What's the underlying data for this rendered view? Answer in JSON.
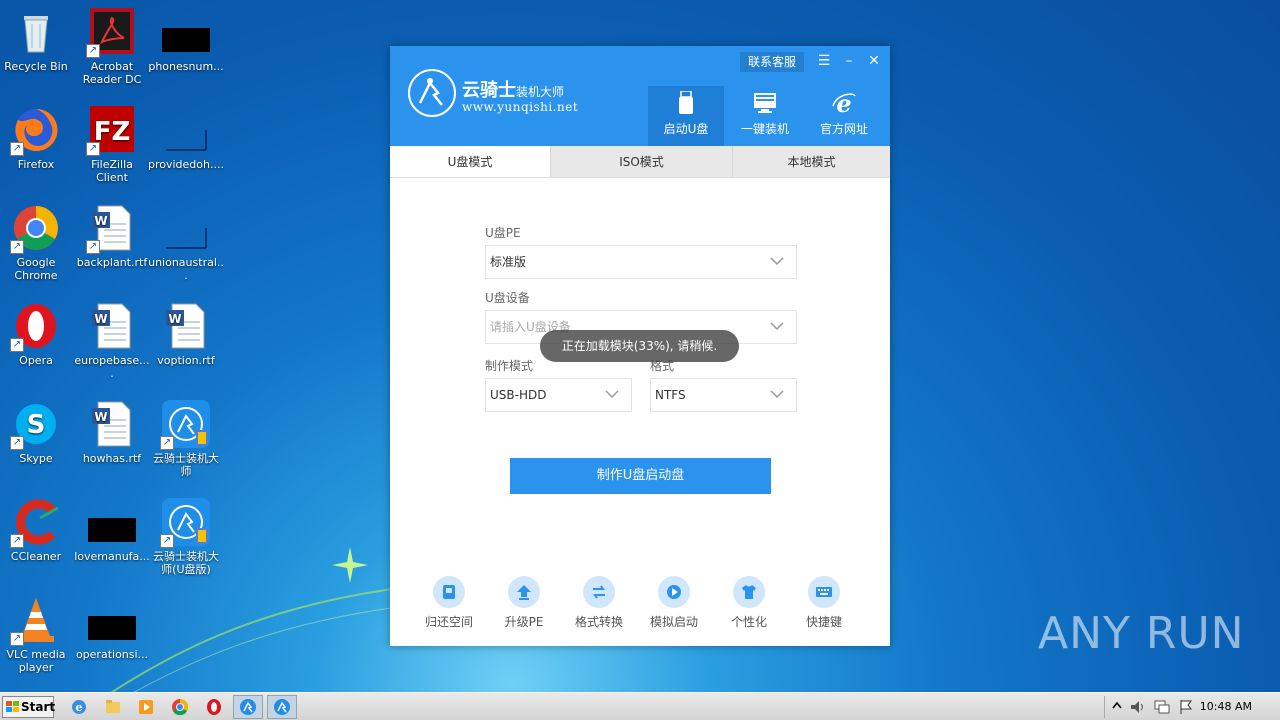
{
  "desktop": {
    "icons": [
      {
        "label": "Recycle Bin",
        "icon": "recycle-bin-icon"
      },
      {
        "label": "Acrobat Reader DC",
        "icon": "acrobat-icon"
      },
      {
        "label": "phonesnum...",
        "icon": "black-file-icon"
      },
      {
        "label": "Firefox",
        "icon": "firefox-icon"
      },
      {
        "label": "FileZilla Client",
        "icon": "filezilla-icon"
      },
      {
        "label": "providedoh....",
        "icon": "blank-file-icon"
      },
      {
        "label": "Google Chrome",
        "icon": "chrome-icon"
      },
      {
        "label": "backplant.rtf",
        "icon": "word-doc-icon"
      },
      {
        "label": "unionaustral...",
        "icon": "blank-file-icon"
      },
      {
        "label": "Opera",
        "icon": "opera-icon"
      },
      {
        "label": "europebase....",
        "icon": "word-doc-icon"
      },
      {
        "label": "voption.rtf",
        "icon": "word-doc-icon"
      },
      {
        "label": "Skype",
        "icon": "skype-icon"
      },
      {
        "label": "howhas.rtf",
        "icon": "word-doc-icon"
      },
      {
        "label": "云骑士装机大师",
        "icon": "yunqishi-icon"
      },
      {
        "label": "CCleaner",
        "icon": "ccleaner-icon"
      },
      {
        "label": "lovemanufa...",
        "icon": "black-file-icon"
      },
      {
        "label": "云骑士装机大师(U盘版)",
        "icon": "yunqishi-icon"
      },
      {
        "label": "VLC media player",
        "icon": "vlc-icon"
      },
      {
        "label": "operationsi...",
        "icon": "black-file-icon"
      }
    ]
  },
  "app": {
    "brand_main": "云骑士",
    "brand_sub": "装机大师",
    "brand_url": "www.yunqishi.net",
    "service_label": "联系客服",
    "nav": [
      {
        "label": "启动U盘",
        "icon": "usb-drive-icon"
      },
      {
        "label": "一键装机",
        "icon": "monitor-icon"
      },
      {
        "label": "官方网址",
        "icon": "ie-icon"
      }
    ],
    "tabs": [
      {
        "label": "U盘模式"
      },
      {
        "label": "ISO模式"
      },
      {
        "label": "本地模式"
      }
    ],
    "form": {
      "pe_label": "U盘PE",
      "pe_value": "标准版",
      "device_label": "U盘设备",
      "device_placeholder": "请插入U盘设备",
      "mode_label": "制作模式",
      "mode_value": "USB-HDD",
      "format_label": "格式",
      "format_value": "NTFS"
    },
    "toast": "正在加载模块(33%), 请稍候.",
    "primary_button": "制作U盘启动盘",
    "tools": [
      {
        "label": "归还空间",
        "icon": "disk-icon"
      },
      {
        "label": "升级PE",
        "icon": "upload-icon"
      },
      {
        "label": "格式转换",
        "icon": "convert-icon"
      },
      {
        "label": "模拟启动",
        "icon": "play-icon"
      },
      {
        "label": "个性化",
        "icon": "shirt-icon"
      },
      {
        "label": "快捷键",
        "icon": "keyboard-icon"
      }
    ]
  },
  "taskbar": {
    "start_label": "Start",
    "clock": "10:48 AM"
  },
  "watermark": "ANY RUN"
}
